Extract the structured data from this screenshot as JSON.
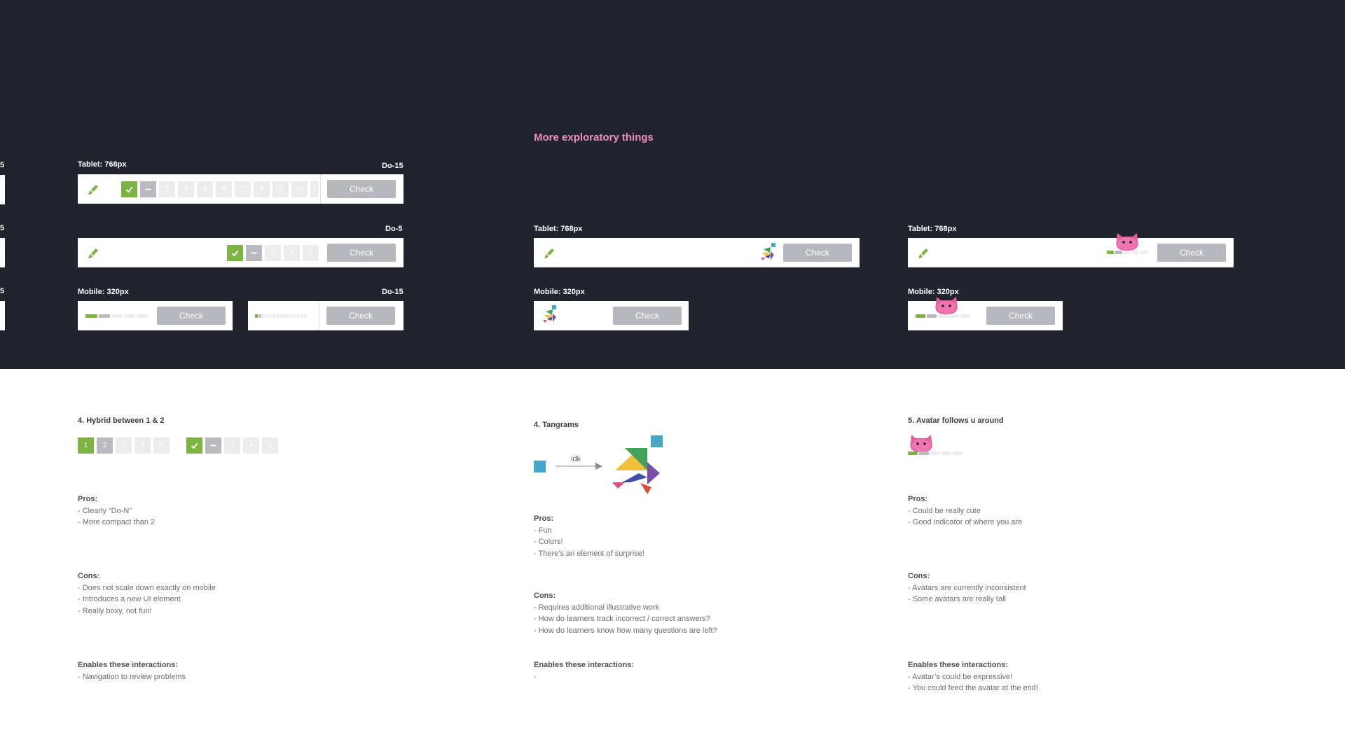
{
  "section_title": "More exploratory things",
  "dark": {
    "edge_label": "5",
    "col1": {
      "row1": {
        "label": "Tablet: 768px",
        "tag": "Do-15",
        "squares": [
          "",
          "",
          "3",
          "4",
          "5",
          "6",
          "7",
          "8",
          "9",
          "10",
          "1"
        ],
        "check": "Check"
      },
      "row2": {
        "tag": "Do-5",
        "squares": [
          "",
          "",
          "3",
          "4",
          "5"
        ],
        "check": "Check"
      },
      "row3": {
        "label": "Mobile: 320px",
        "tag": "Do-15",
        "check_a": "Check",
        "check_b": "Check"
      }
    },
    "col2": {
      "row2": {
        "label": "Tablet: 768px",
        "check": "Check"
      },
      "row3": {
        "label": "Mobile: 320px",
        "check": "Check"
      }
    },
    "col3": {
      "row2": {
        "label": "Tablet: 768px",
        "check": "Check"
      },
      "row3": {
        "label": "Mobile: 320px",
        "check": "Check"
      }
    }
  },
  "concepts": {
    "hybrid": {
      "title": "4. Hybrid between 1 & 2",
      "squares_a": [
        "1",
        "2",
        "3",
        "4",
        "5"
      ],
      "squares_b": [
        "",
        "",
        "3",
        "4",
        "5"
      ],
      "pros_label": "Pros:",
      "pros": [
        "- Clearly “Do-N”",
        "- More compact than 2"
      ],
      "cons_label": "Cons:",
      "cons": [
        "- Does not scale down exactly on mobile",
        "- Introduces a new UI element",
        "- Really boxy, not fun!"
      ],
      "enables_label": "Enables these interactions:",
      "enables": [
        "- Navigation to review problems"
      ]
    },
    "tangrams": {
      "title": "4. Tangrams",
      "arrow_label": "idk",
      "pros_label": "Pros:",
      "pros": [
        "- Fun",
        "- Colors!",
        "- There’s an element of surprise!"
      ],
      "cons_label": "Cons:",
      "cons": [
        "- Requires additional illustrative work",
        "- How do learners track incorrect / correct answers?",
        "- How do learners know how many questions are left?"
      ],
      "enables_label": "Enables these interactions:",
      "enables": [
        "-"
      ]
    },
    "avatar": {
      "title": "5. Avatar follows u around",
      "pros_label": "Pros:",
      "pros": [
        "- Could be really cute",
        "- Good indicator of where you are"
      ],
      "cons_label": "Cons:",
      "cons": [
        "- Avatars are currently inconsistent",
        "- Some avatars are really tall"
      ],
      "enables_label": "Enables these interactions:",
      "enables": [
        "- Avatar’s could be expressive!",
        "- You could feed the avatar at the end!"
      ]
    }
  },
  "colors": {
    "dark_bg": "#21242c",
    "accent_pink": "#ee8ec3",
    "green": "#7cb342",
    "check_gray": "#b6b8be",
    "avatar_pink": "#e35f9f"
  }
}
